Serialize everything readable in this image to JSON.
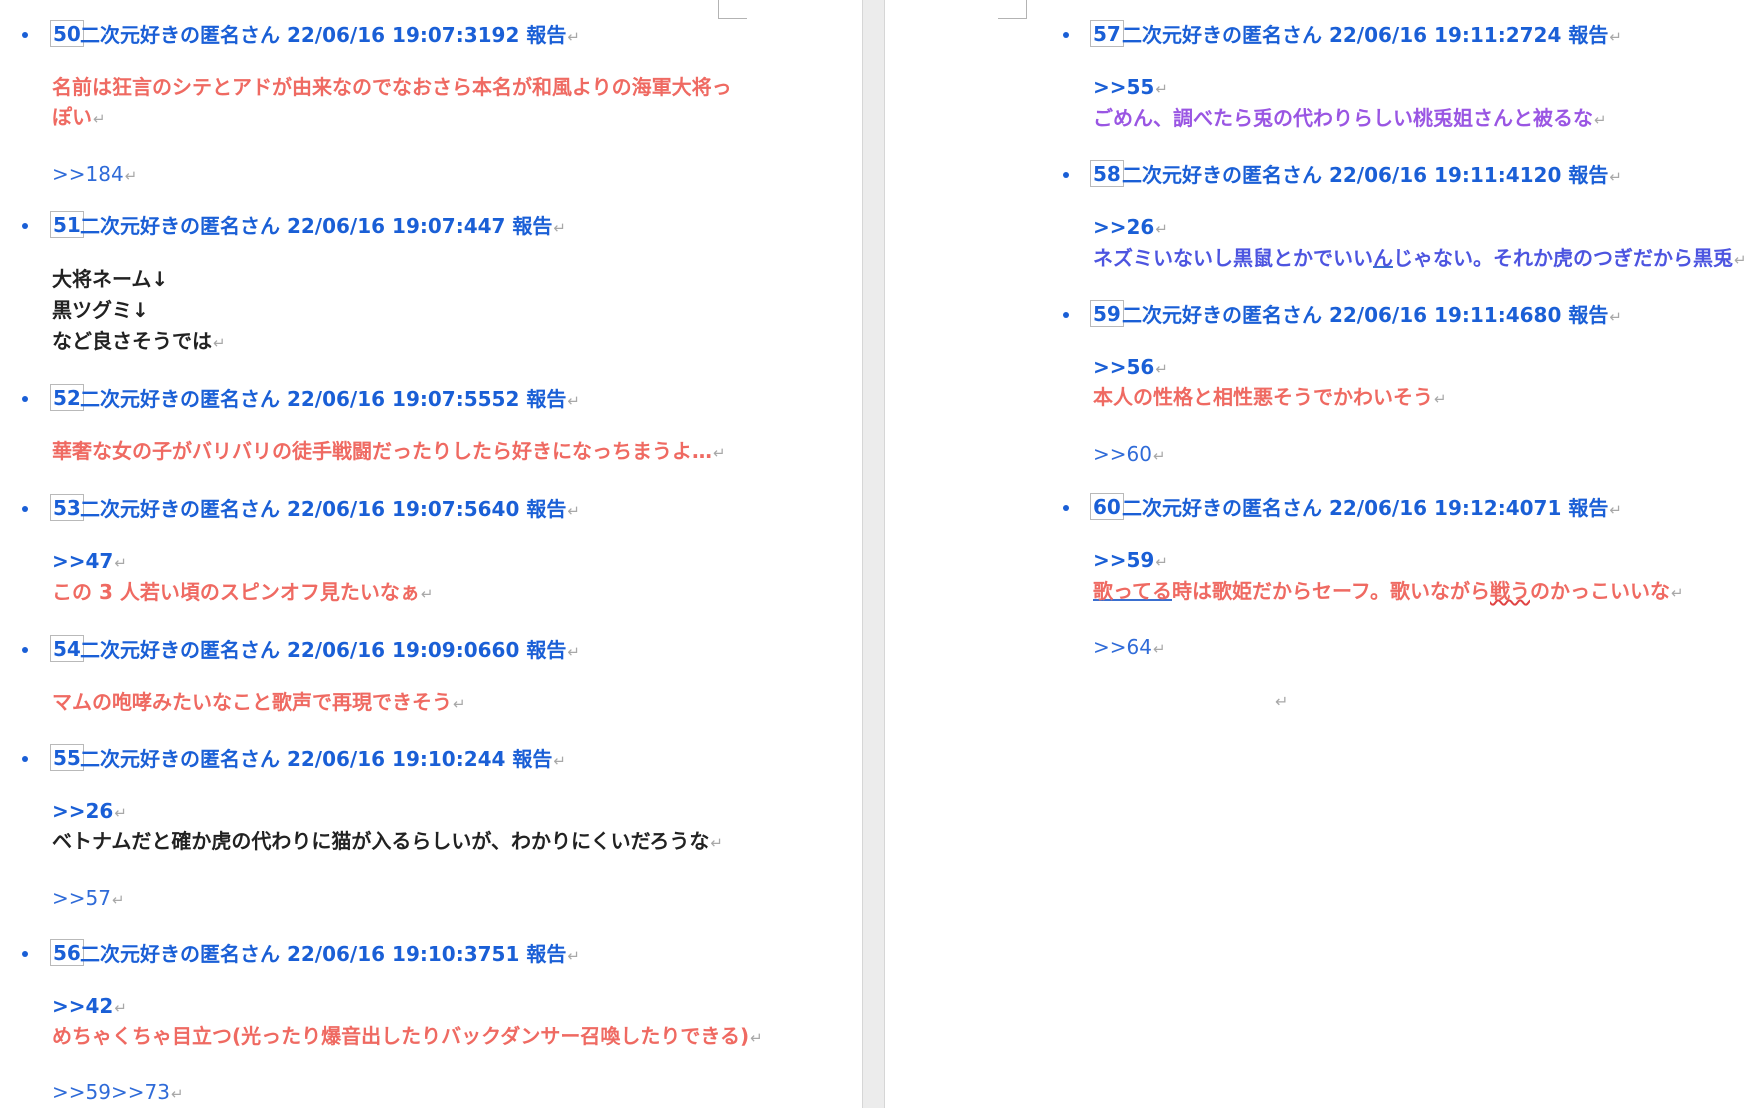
{
  "return_mark": "↵",
  "left_posts": [
    {
      "num": "50",
      "header": "二次元好きの匿名さん 22/06/16 19:07:3192 報告",
      "lines": [
        "名前は狂言のシテとアドが由来なのでなおさら本名が和風よりの海軍大将っ",
        "ぽい"
      ],
      "reply": ">>184"
    },
    {
      "num": "51",
      "header": "二次元好きの匿名さん 22/06/16 19:07:447 報告",
      "lines": [
        "大将ネーム↓",
        "黒ツグミ↓",
        "など良さそうでは"
      ]
    },
    {
      "num": "52",
      "header": "二次元好きの匿名さん 22/06/16 19:07:5552 報告",
      "lines": [
        "華奢な女の子がバリバリの徒手戦闘だったりしたら好きになっちまうよ…"
      ]
    },
    {
      "num": "53",
      "header": "二次元好きの匿名さん 22/06/16 19:07:5640 報告",
      "quote": ">>47",
      "lines": [
        "この 3 人若い頃のスピンオフ見たいなぁ"
      ]
    },
    {
      "num": "54",
      "header": "二次元好きの匿名さん 22/06/16 19:09:0660 報告",
      "lines": [
        "マムの咆哮みたいなこと歌声で再現できそう"
      ]
    },
    {
      "num": "55",
      "header": "二次元好きの匿名さん 22/06/16 19:10:244 報告",
      "quote": ">>26",
      "lines": [
        "ベトナムだと確か虎の代わりに猫が入るらしいが、わかりにくいだろうな"
      ],
      "reply": ">>57"
    },
    {
      "num": "56",
      "header": "二次元好きの匿名さん 22/06/16 19:10:3751 報告",
      "quote": ">>42",
      "lines": [
        "めちゃくちゃ目立つ(光ったり爆音出したりバックダンサー召喚したりできる)"
      ],
      "reply": ">>59>>73"
    }
  ],
  "right_posts": [
    {
      "num": "57",
      "header": "二次元好きの匿名さん 22/06/16 19:11:2724 報告",
      "quote": ">>55",
      "lines": [
        "ごめん、調べたら兎の代わりらしい桃兎姐さんと被るな"
      ]
    },
    {
      "num": "58",
      "header": "二次元好きの匿名さん 22/06/16 19:11:4120 報告",
      "quote": ">>26",
      "line_parts": [
        "ネズミいないし黒鼠とかでいい",
        "ん",
        "じゃない。それか虎のつぎだから黒兎"
      ]
    },
    {
      "num": "59",
      "header": "二次元好きの匿名さん 22/06/16 19:11:4680 報告",
      "quote": ">>56",
      "lines": [
        "本人の性格と相性悪そうでかわいそう"
      ],
      "reply": ">>60"
    },
    {
      "num": "60",
      "header": "二次元好きの匿名さん 22/06/16 19:12:4071 報告",
      "quote": ">>59",
      "line_parts": [
        "歌ってる",
        "時は歌姫だからセーフ。歌いながら",
        "戦う",
        "のかっこいいな"
      ],
      "reply": ">>64"
    }
  ],
  "colors": {
    "header_blue": "#1a5fd6",
    "body_red": "#ef6a62",
    "body_purple": "#9a56e3",
    "body_indigo": "#4d55e0",
    "body_black": "#222222"
  }
}
